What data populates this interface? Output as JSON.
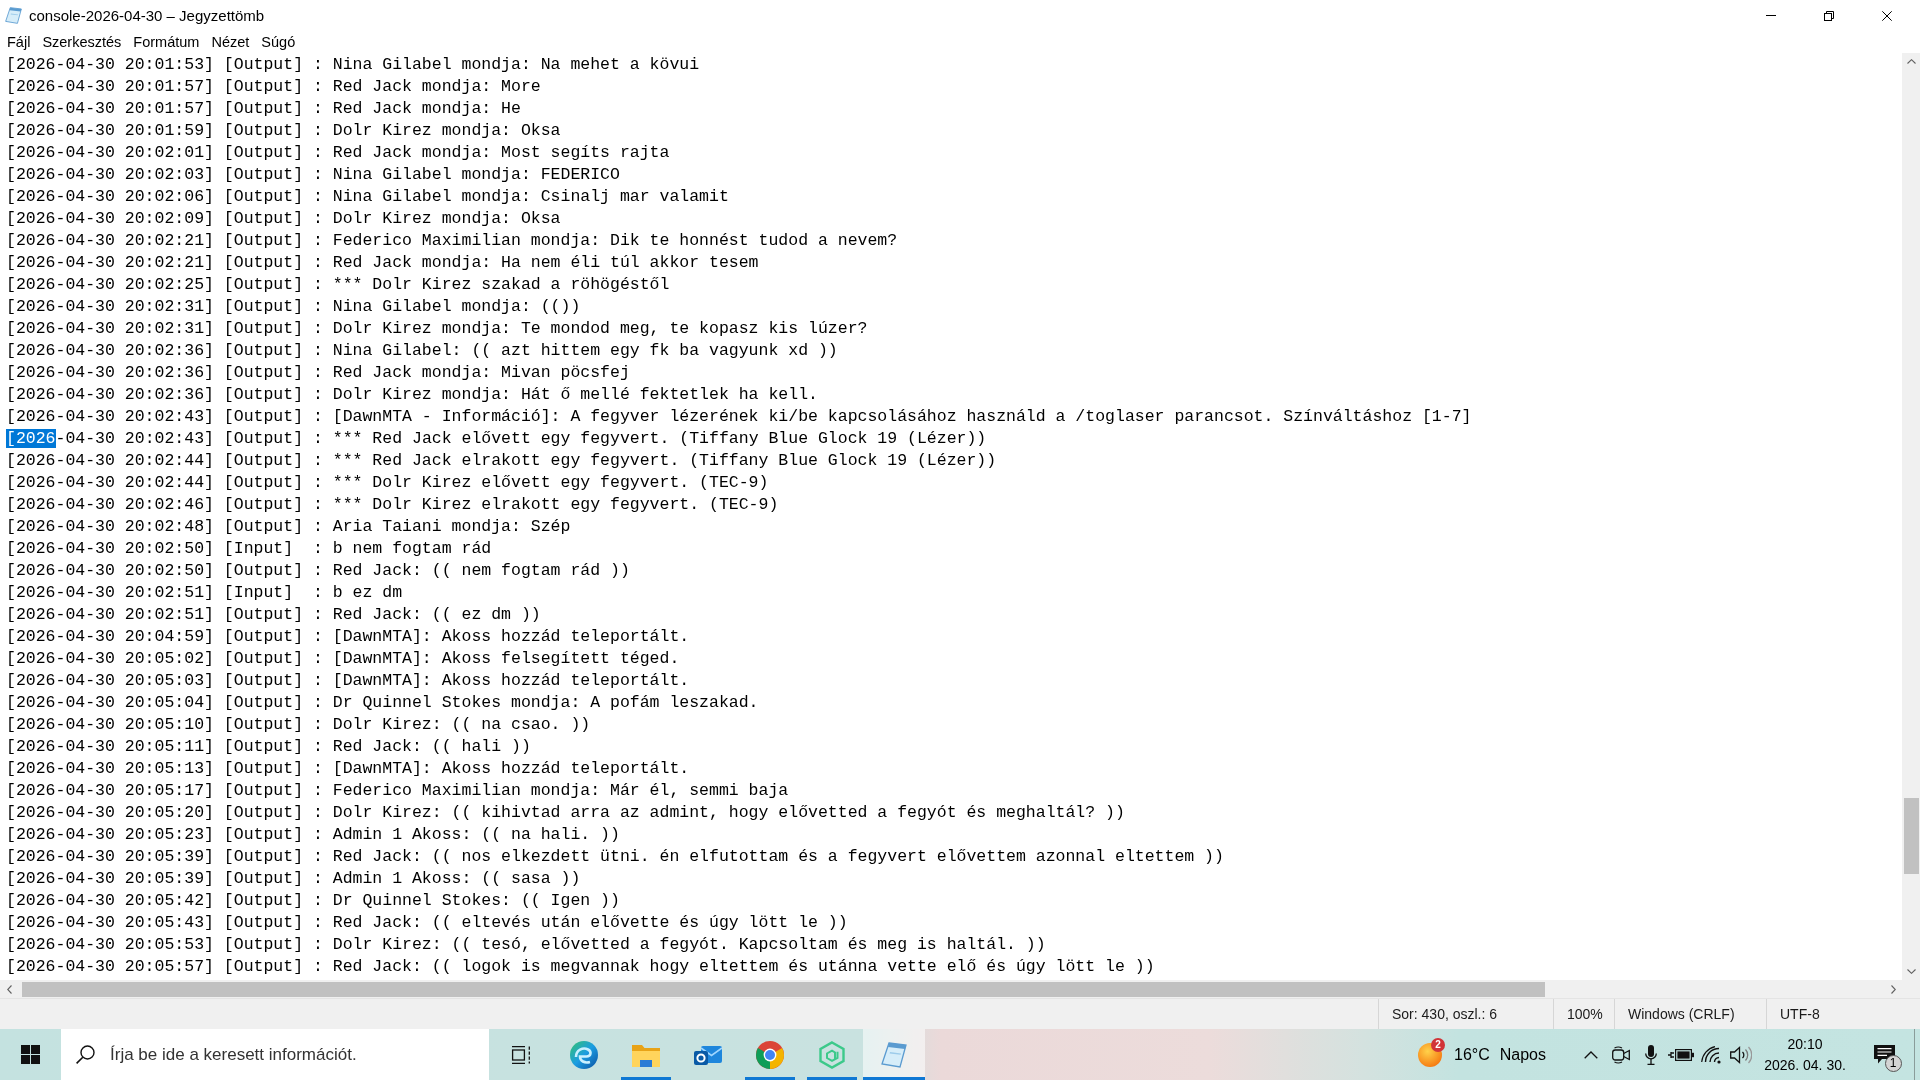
{
  "window": {
    "title": "console-2026-04-30 – Jegyzettömb",
    "maximized": true
  },
  "menu": [
    "Fájl",
    "Szerkesztés",
    "Formátum",
    "Nézet",
    "Súgó"
  ],
  "editor": {
    "lines": [
      {
        "text": "[2026-04-30 20:01:53] [Output] : Nina Gilabel mondja: Na mehet a kövui"
      },
      {
        "text": "[2026-04-30 20:01:57] [Output] : Red Jack mondja: More"
      },
      {
        "text": "[2026-04-30 20:01:57] [Output] : Red Jack mondja: He"
      },
      {
        "text": "[2026-04-30 20:01:59] [Output] : Dolr Kirez mondja: Oksa"
      },
      {
        "text": "[2026-04-30 20:02:01] [Output] : Red Jack mondja: Most segíts rajta"
      },
      {
        "text": "[2026-04-30 20:02:03] [Output] : Nina Gilabel mondja: FEDERICO"
      },
      {
        "text": "[2026-04-30 20:02:06] [Output] : Nina Gilabel mondja: Csinalj mar valamit"
      },
      {
        "text": "[2026-04-30 20:02:09] [Output] : Dolr Kirez mondja: Oksa"
      },
      {
        "text": "[2026-04-30 20:02:21] [Output] : Federico Maximilian mondja: Dik te honnést tudod a nevem?"
      },
      {
        "text": "[2026-04-30 20:02:21] [Output] : Red Jack mondja: Ha nem éli túl akkor tesem"
      },
      {
        "text": "[2026-04-30 20:02:25] [Output] : *** Dolr Kirez szakad a röhögéstől"
      },
      {
        "text": "[2026-04-30 20:02:31] [Output] : Nina Gilabel mondja: (())"
      },
      {
        "text": "[2026-04-30 20:02:31] [Output] : Dolr Kirez mondja: Te mondod meg, te kopasz kis lúzer?"
      },
      {
        "text": "[2026-04-30 20:02:36] [Output] : Nina Gilabel: (( azt hittem egy fk ba vagyunk xd ))"
      },
      {
        "text": "[2026-04-30 20:02:36] [Output] : Red Jack mondja: Mivan pöcsfej"
      },
      {
        "text": "[2026-04-30 20:02:36] [Output] : Dolr Kirez mondja: Hát ő mellé fektetlek ha kell."
      },
      {
        "text": "[2026-04-30 20:02:43] [Output] : [DawnMTA - Információ]: A fegyver lézerének ki/be kapcsolásához használd a /toglaser parancsot. Színváltáshoz [1-7]"
      },
      {
        "selection": "[2026",
        "text": "-04-30 20:02:43] [Output] : *** Red Jack elővett egy fegyvert. (Tiffany Blue Glock 19 (Lézer))"
      },
      {
        "text": "[2026-04-30 20:02:44] [Output] : *** Red Jack elrakott egy fegyvert. (Tiffany Blue Glock 19 (Lézer))"
      },
      {
        "text": "[2026-04-30 20:02:44] [Output] : *** Dolr Kirez elővett egy fegyvert. (TEC-9)"
      },
      {
        "text": "[2026-04-30 20:02:46] [Output] : *** Dolr Kirez elrakott egy fegyvert. (TEC-9)"
      },
      {
        "text": "[2026-04-30 20:02:48] [Output] : Aria Taiani mondja: Szép"
      },
      {
        "text": "[2026-04-30 20:02:50] [Input]  : b nem fogtam rád"
      },
      {
        "text": "[2026-04-30 20:02:50] [Output] : Red Jack: (( nem fogtam rád ))"
      },
      {
        "text": "[2026-04-30 20:02:51] [Input]  : b ez dm"
      },
      {
        "text": "[2026-04-30 20:02:51] [Output] : Red Jack: (( ez dm ))"
      },
      {
        "text": "[2026-04-30 20:04:59] [Output] : [DawnMTA]: Akoss hozzád teleportált."
      },
      {
        "text": "[2026-04-30 20:05:02] [Output] : [DawnMTA]: Akoss felsegített téged."
      },
      {
        "text": "[2026-04-30 20:05:03] [Output] : [DawnMTA]: Akoss hozzád teleportált."
      },
      {
        "text": "[2026-04-30 20:05:04] [Output] : Dr Quinnel Stokes mondja: A pofám leszakad."
      },
      {
        "text": "[2026-04-30 20:05:10] [Output] : Dolr Kirez: (( na csao. ))"
      },
      {
        "text": "[2026-04-30 20:05:11] [Output] : Red Jack: (( hali ))"
      },
      {
        "text": "[2026-04-30 20:05:13] [Output] : [DawnMTA]: Akoss hozzád teleportált."
      },
      {
        "text": "[2026-04-30 20:05:17] [Output] : Federico Maximilian mondja: Már él, semmi baja"
      },
      {
        "text": "[2026-04-30 20:05:20] [Output] : Dolr Kirez: (( kihivtad arra az admint, hogy elővetted a fegyót és meghaltál? ))"
      },
      {
        "text": "[2026-04-30 20:05:23] [Output] : Admin 1 Akoss: (( na hali. ))"
      },
      {
        "text": "[2026-04-30 20:05:39] [Output] : Red Jack: (( nos elkezdett ütni. én elfutottam és a fegyvert elővettem azonnal eltettem ))"
      },
      {
        "text": "[2026-04-30 20:05:39] [Output] : Admin 1 Akoss: (( sasa ))"
      },
      {
        "text": "[2026-04-30 20:05:42] [Output] : Dr Quinnel Stokes: (( Igen ))"
      },
      {
        "text": "[2026-04-30 20:05:43] [Output] : Red Jack: (( eltevés után elővette és úgy lött le ))"
      },
      {
        "text": "[2026-04-30 20:05:53] [Output] : Dolr Kirez: (( tesó, elővetted a fegyót. Kapcsoltam és meg is haltál. ))"
      },
      {
        "text": "[2026-04-30 20:05:57] [Output] : Red Jack: (( logok is megvannak hogy eltettem és utánna vette elő és úgy lött le ))"
      }
    ]
  },
  "status_bar": {
    "position": "Sor: 430, oszl.: 6",
    "zoom": "100%",
    "line_ending": "Windows (CRLF)",
    "encoding": "UTF-8"
  },
  "taskbar": {
    "search": {
      "placeholder": "Írja be ide a keresett információt."
    },
    "apps": [
      {
        "kind": "swirl",
        "running": false,
        "active": false
      },
      {
        "kind": "folder",
        "running": true,
        "active": false
      },
      {
        "kind": "mail",
        "running": false,
        "active": false
      },
      {
        "kind": "wheel",
        "running": true,
        "active": false
      },
      {
        "kind": "hexagon",
        "running": true,
        "active": false
      },
      {
        "kind": "notepad",
        "running": true,
        "active": true
      }
    ],
    "weather": {
      "badge": "2",
      "temperature": "16°C",
      "condition": "Napos"
    },
    "clock": {
      "time": "20:10",
      "date": "2026. 04. 30."
    },
    "notifications": {
      "badge": "1"
    }
  }
}
